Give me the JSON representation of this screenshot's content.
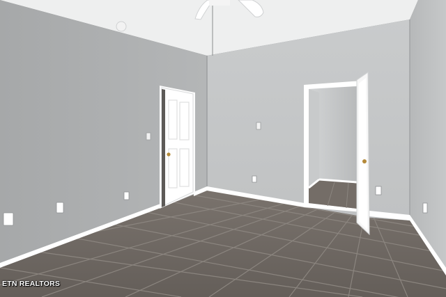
{
  "watermark": {
    "text": "ETN REALTORS"
  },
  "colors": {
    "ceiling": "#eeefef",
    "left_wall": "#a8aaab",
    "back_wall": "#c4c6c7",
    "right_wall": "#bfc1c2",
    "floor": "#6c6661",
    "grout": "#8b857f",
    "trim": "#ffffff"
  },
  "icons": [
    "ceiling-fan-icon",
    "smoke-detector-icon",
    "light-switch-icon",
    "outlet-icon",
    "door-knob-icon"
  ]
}
